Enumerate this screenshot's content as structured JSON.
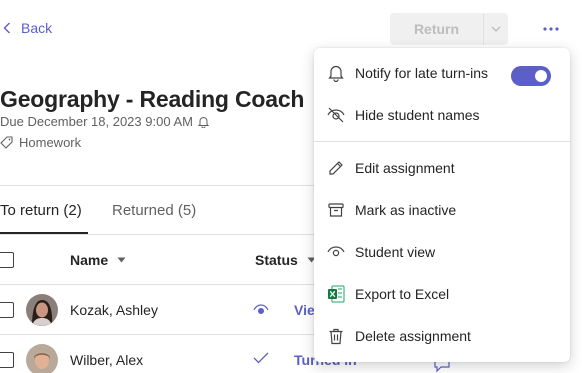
{
  "header": {
    "back_label": "Back",
    "return_label": "Return"
  },
  "assignment": {
    "title": "Geography - Reading Coach",
    "due": "Due December 18, 2023 9:00 AM",
    "category": "Homework"
  },
  "tabs": [
    {
      "label": "To return (2)",
      "active": true
    },
    {
      "label": "Returned (5)",
      "active": false
    }
  ],
  "table": {
    "columns": [
      "Name",
      "Status"
    ],
    "rows": [
      {
        "name": "Kozak, Ashley",
        "status": "Viewed",
        "status_icon": "eye-icon"
      },
      {
        "name": "Wilber, Alex",
        "status": "Turned in",
        "status_icon": "checkmark-icon"
      }
    ]
  },
  "menu": {
    "items": [
      {
        "label": "Notify for late turn-ins",
        "icon": "bell-icon",
        "toggle_on": true
      },
      {
        "label": "Hide student names",
        "icon": "eye-off-icon"
      },
      {
        "label": "Edit assignment",
        "icon": "pencil-icon"
      },
      {
        "label": "Mark as inactive",
        "icon": "archive-icon"
      },
      {
        "label": "Student view",
        "icon": "eye-icon"
      },
      {
        "label": "Export to Excel",
        "icon": "excel-icon"
      },
      {
        "label": "Delete assignment",
        "icon": "trash-icon"
      }
    ]
  },
  "colors": {
    "accent": "#5b5fc7",
    "text": "#242424",
    "muted": "#616161",
    "excel_green": "#107c41"
  }
}
